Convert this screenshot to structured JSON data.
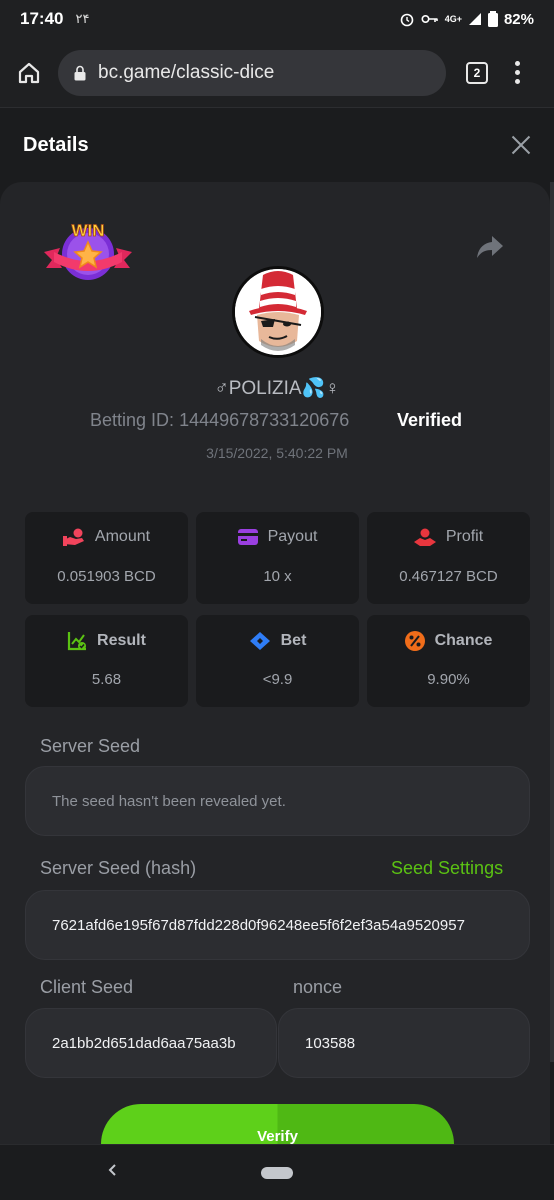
{
  "status_bar": {
    "time": "17:40",
    "extra": "۲۴",
    "network": "4G+",
    "battery": "82%"
  },
  "browser": {
    "url": "bc.game/classic-dice",
    "tab_count": "2"
  },
  "dialog": {
    "title": "Details"
  },
  "bet": {
    "badge_text": "WIN",
    "username": "♂POLIZIA💦♀",
    "betting_id_label": "Betting ID:",
    "betting_id": "14449678733120676",
    "status": "Verified",
    "timestamp": "3/15/2022, 5:40:22 PM"
  },
  "stats": [
    {
      "label": "Amount",
      "value": "0.051903 BCD",
      "icon": "hand-coins-icon",
      "color": "#f2445c"
    },
    {
      "label": "Payout",
      "value": "10 x",
      "icon": "card-icon",
      "color": "#9a3fe0"
    },
    {
      "label": "Profit",
      "value": "0.467127 BCD",
      "icon": "profit-icon",
      "color": "#e8363e"
    },
    {
      "label": "Result",
      "value": "5.68",
      "icon": "chart-check-icon",
      "color": "#5bc213"
    },
    {
      "label": "Bet",
      "value": "<9.9",
      "icon": "diamond-tag-icon",
      "color": "#2f7df6"
    },
    {
      "label": "Chance",
      "value": "9.90%",
      "icon": "percent-icon",
      "color": "#f06d1a"
    }
  ],
  "fairness": {
    "server_seed_label": "Server Seed",
    "server_seed_value": "The seed hasn't been revealed yet.",
    "server_seed_hash_label": "Server Seed (hash)",
    "seed_settings_label": "Seed Settings",
    "server_seed_hash": "7621afd6e195f67d87fdd228d0f96248ee5f6f2ef3a54a9520957",
    "client_seed_label": "Client Seed",
    "client_seed": "2a1bb2d651dad6aa75aa3b",
    "nonce_label": "nonce",
    "nonce": "103588",
    "verify_label": "Verify"
  },
  "colors": {
    "accent_green": "#5bc213",
    "panel_bg": "#242528",
    "card_bg": "#1a1b1d"
  }
}
